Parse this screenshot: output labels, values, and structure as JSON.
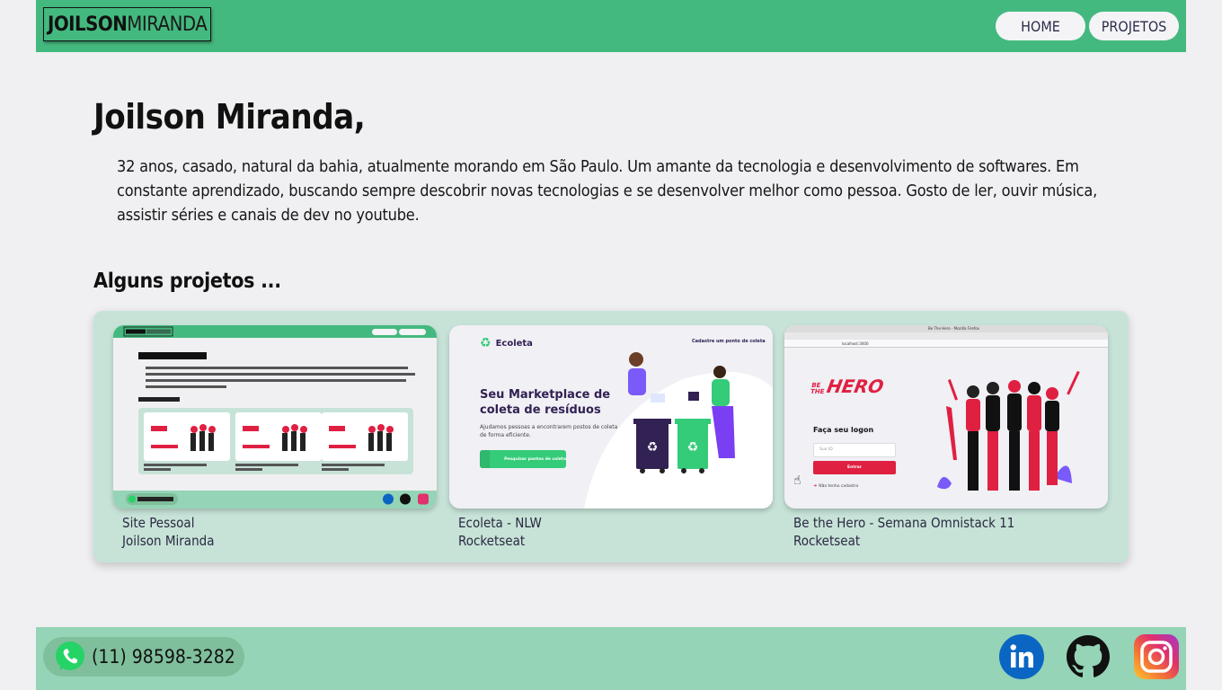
{
  "header": {
    "logo_bold": "JOILSON",
    "logo_light": "MIRANDA",
    "nav": {
      "home": "HOME",
      "projects": "PROJETOS"
    }
  },
  "intro": {
    "title": "Joilson Miranda,",
    "bio": "32 anos, casado, natural da bahia, atualmente morando em São Paulo. Um amante da tecnologia e desenvolvimento de softwares. Em constante aprendizado, buscando sempre descobrir novas tecnologias e se desenvolver melhor como pessoa. Gosto de ler, ouvir música, assistir séries e canais de dev no youtube."
  },
  "projects": {
    "title": "Alguns projetos ...",
    "items": [
      {
        "name": "Site Pessoal",
        "author": "Joilson Miranda"
      },
      {
        "name": "Ecoleta - NLW",
        "author": "Rocketseat"
      },
      {
        "name": "Be the Hero - Semana Omnistack 11",
        "author": "Rocketseat"
      }
    ],
    "ecoleta_shot": {
      "brand": "Ecoleta",
      "link": "Cadastre um ponto de coleta",
      "headline1": "Seu Marketplace de",
      "headline2": "coleta de resíduos",
      "sub1": "Ajudamos pessoas a encontrarem postos de coleta",
      "sub2": "de forma eficiente.",
      "button": "Pesquisar pontos de coleta"
    },
    "hero_shot": {
      "brand1": "BE",
      "brand2": "THE",
      "brand3": "HERO",
      "heading": "Faça seu logon",
      "placeholder": "Sua ID",
      "button": "Entrar",
      "link": "Não tenho cadastro",
      "window_title": "Be The Hero - Mozilla Firefox",
      "url": "localhost:3000"
    }
  },
  "footer": {
    "phone": "(11) 98598-3282",
    "colors": {
      "whatsapp": "#25d366",
      "linkedin": "#0a66c2",
      "github": "#111111"
    }
  },
  "colors": {
    "header": "#44b97f",
    "footer": "#95d4b6",
    "projects_bg": "#c7e3d8",
    "hero_red": "#e02041",
    "ecoleta_green": "#34cb79"
  }
}
